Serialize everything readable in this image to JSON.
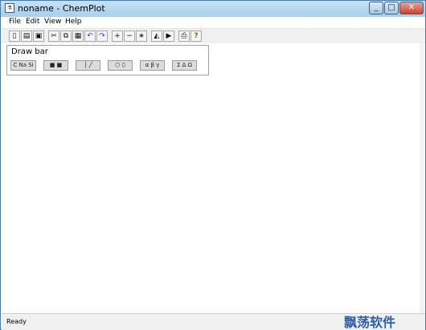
{
  "window": {
    "title": "noname - ChemPlot"
  },
  "menu": [
    {
      "label": "File"
    },
    {
      "label": "Edit"
    },
    {
      "label": "View"
    },
    {
      "label": "Help"
    }
  ],
  "toolbar": {
    "buttons": [
      {
        "name": "new-button",
        "icon": "new-document-icon",
        "glyph": "▯"
      },
      {
        "name": "open-button",
        "icon": "open-folder-icon",
        "glyph": "▤"
      },
      {
        "name": "save-button",
        "icon": "floppy-disk-icon",
        "glyph": "▣"
      },
      {
        "name": "cut-button",
        "icon": "scissors-icon",
        "glyph": "✂"
      },
      {
        "name": "copy-button",
        "icon": "copy-icon",
        "glyph": "⧉"
      },
      {
        "name": "paste-button",
        "icon": "paste-icon",
        "glyph": "▦"
      },
      {
        "name": "undo-button",
        "icon": "undo-arrow-icon",
        "glyph": "↶"
      },
      {
        "name": "redo-button",
        "icon": "redo-arrow-icon",
        "glyph": "↷"
      },
      {
        "name": "add-button",
        "icon": "plus-icon",
        "glyph": "+"
      },
      {
        "name": "remove-button",
        "icon": "minus-icon",
        "glyph": "−"
      },
      {
        "name": "radical-button",
        "icon": "asterisk-icon",
        "glyph": "∗"
      },
      {
        "name": "flip-button",
        "icon": "flip-icon",
        "glyph": "◭"
      },
      {
        "name": "arrow-button",
        "icon": "play-arrow-icon",
        "glyph": "▶"
      },
      {
        "name": "print-button",
        "icon": "printer-icon",
        "glyph": "⎙"
      },
      {
        "name": "help-button",
        "icon": "question-mark-icon",
        "glyph": "?"
      }
    ]
  },
  "drawbar": {
    "title": "Draw bar",
    "buttons": [
      {
        "name": "elements-button",
        "label": "C Na Si"
      },
      {
        "name": "shapes-button",
        "label": "■ ■"
      },
      {
        "name": "bonds-button",
        "label": "│ ╱"
      },
      {
        "name": "rings-button",
        "label": "⬡ ⬯"
      },
      {
        "name": "greek-lowercase-button",
        "label": "α β γ"
      },
      {
        "name": "greek-uppercase-button",
        "label": "Σ Δ Ω"
      }
    ]
  },
  "status": {
    "text": "Ready"
  },
  "watermark": {
    "text": "飘荡软件"
  },
  "colors": {
    "title_bar": "#b5d7ef",
    "close_button": "#c84131",
    "window_border": "#4a7aa3"
  }
}
